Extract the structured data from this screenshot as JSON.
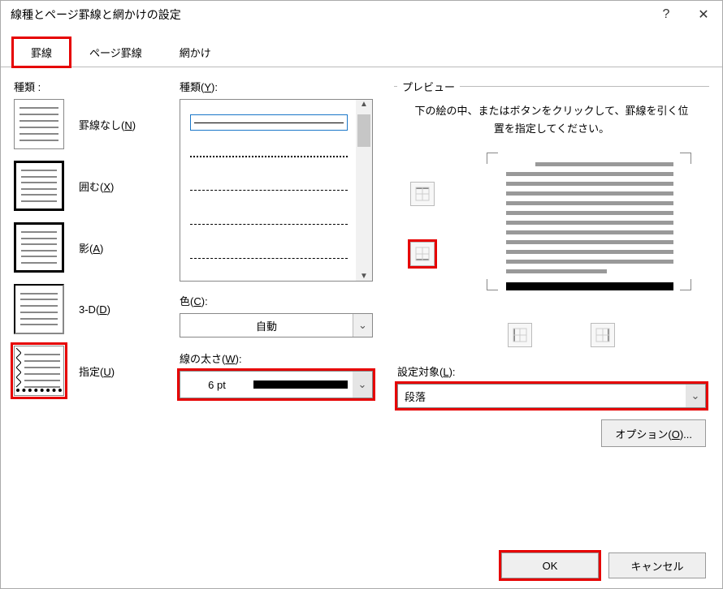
{
  "window": {
    "title": "線種とページ罫線と網かけの設定"
  },
  "tabs": {
    "t1": "罫線",
    "t2": "ページ罫線",
    "t3": "網かけ"
  },
  "col1": {
    "heading": "種類 :",
    "none": "罫線なし(N)",
    "box": "囲む(X)",
    "shadow": "影(A)",
    "threeD": "3-D(D)",
    "custom": "指定(U)"
  },
  "col2": {
    "styleLabel": "種類(Y):",
    "colorLabel": "色(C):",
    "colorValue": "自動",
    "widthLabel": "線の太さ(W):",
    "widthValue": "6 pt"
  },
  "preview": {
    "legend": "プレビュー",
    "hint": "下の絵の中、またはボタンをクリックして、罫線を引く位置を指定してください。",
    "targetLabel": "設定対象(L):",
    "targetValue": "段落",
    "optionsBtn": "オプション(O)..."
  },
  "footer": {
    "ok": "OK",
    "cancel": "キャンセル"
  }
}
